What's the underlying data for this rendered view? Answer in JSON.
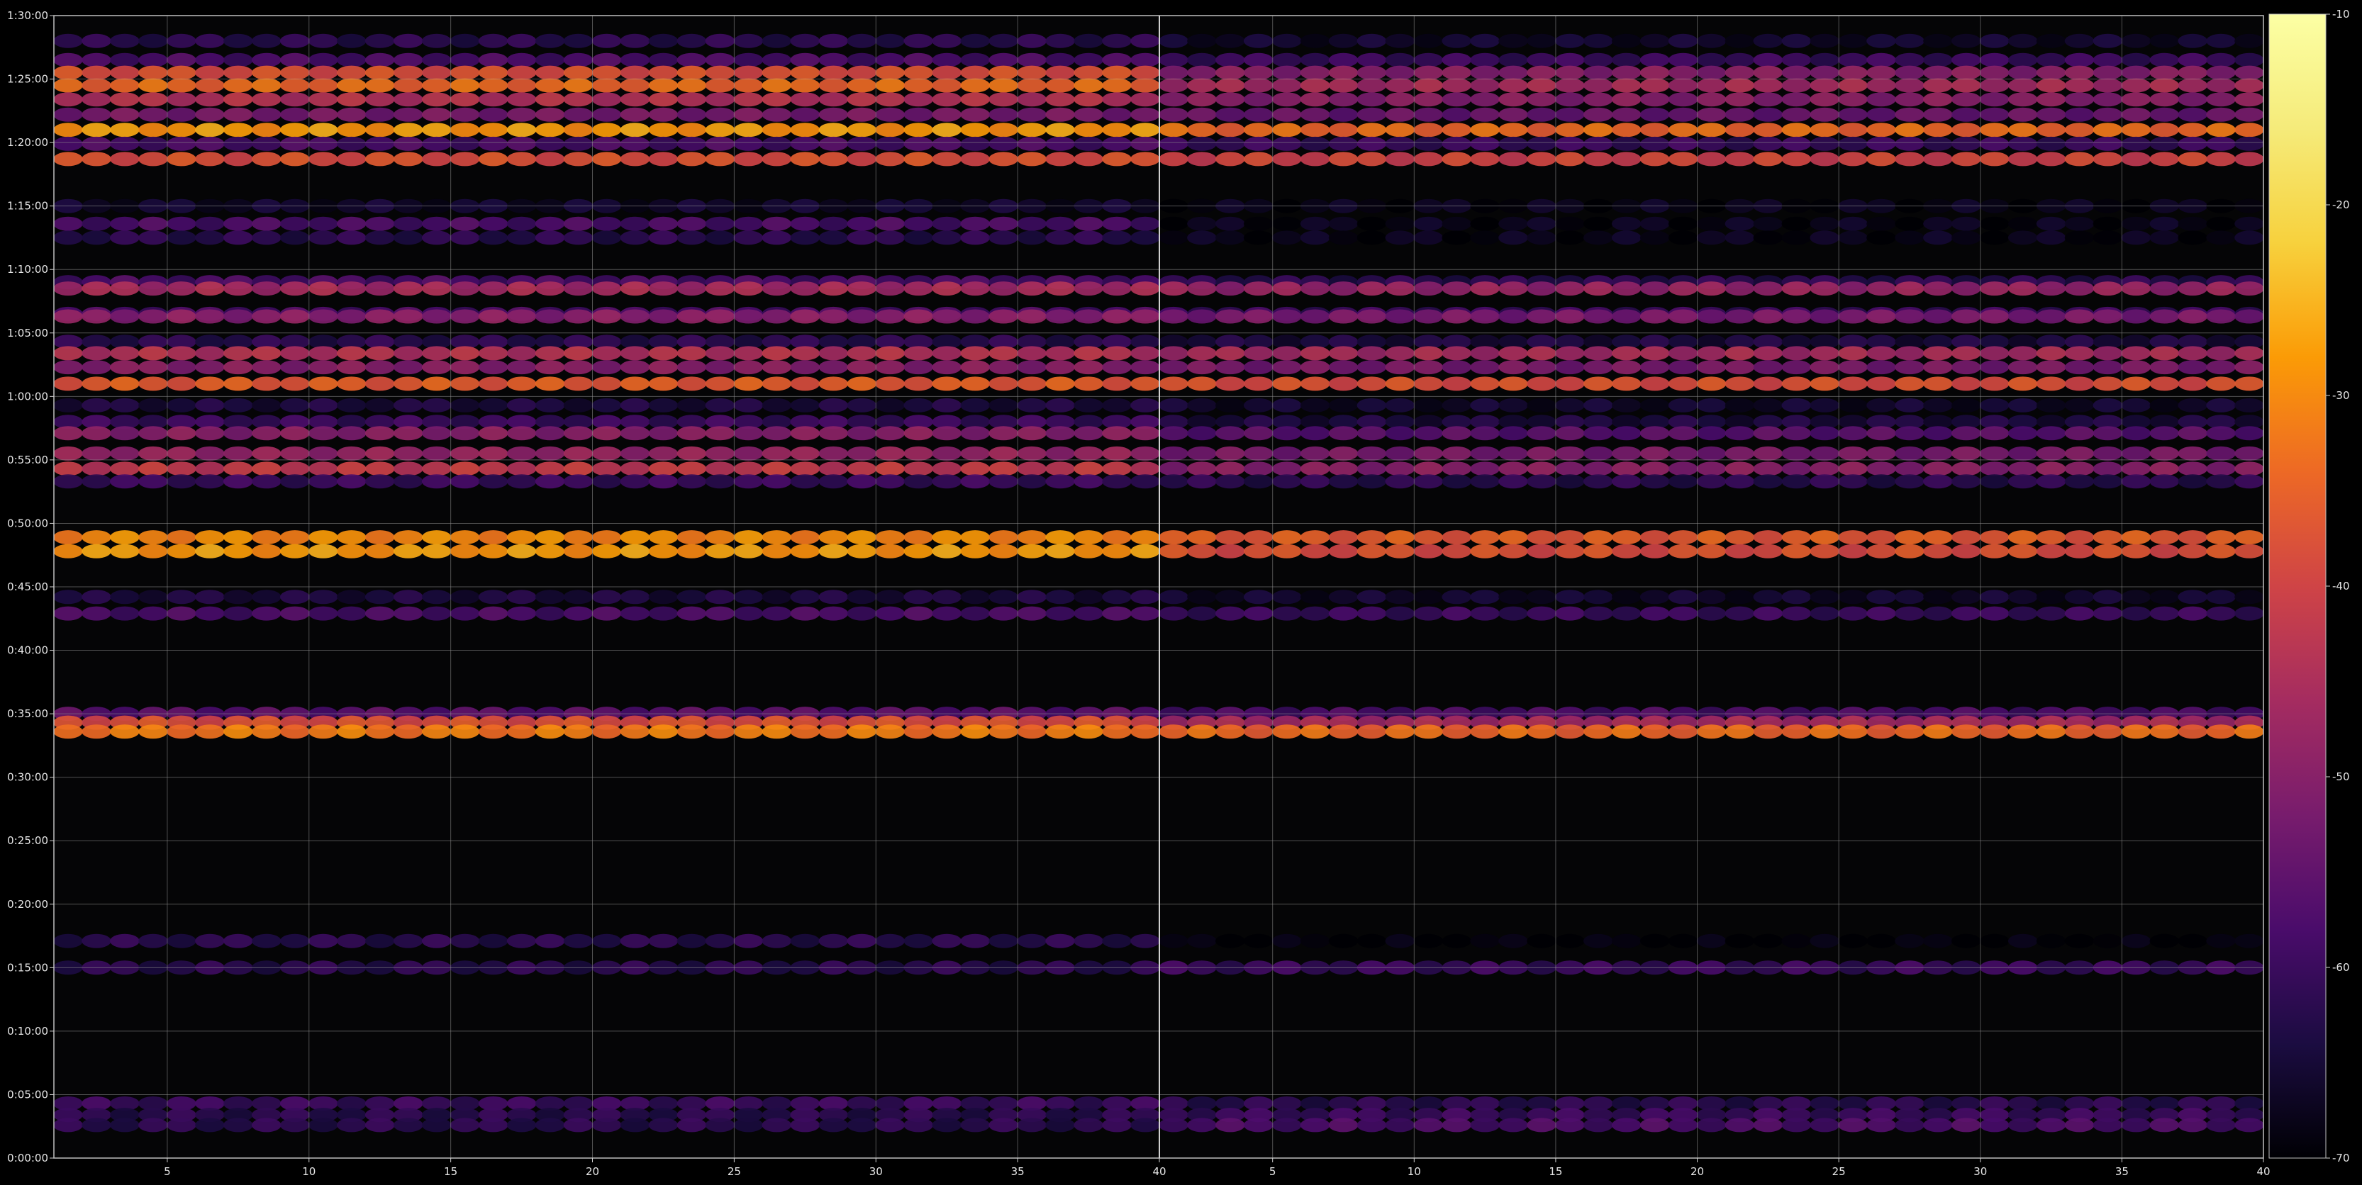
{
  "chart_data": {
    "type": "heatmap",
    "title": "",
    "xlabel": "",
    "ylabel": "",
    "grid": true,
    "background": "#000000",
    "colormap": "inferno",
    "panels": [
      {
        "x_range": [
          1,
          40
        ],
        "x_ticks": [
          "5",
          "10",
          "15",
          "20",
          "25",
          "30",
          "35",
          "40"
        ]
      },
      {
        "x_range": [
          40,
          79
        ],
        "x_ticks": [
          "5",
          "10",
          "15",
          "20",
          "25",
          "30",
          "35",
          "40"
        ]
      }
    ],
    "y_range_minutes": [
      0,
      90
    ],
    "y_ticks": [
      "0:00:00",
      "0:05:00",
      "0:10:00",
      "0:15:00",
      "0:20:00",
      "0:25:00",
      "0:30:00",
      "0:35:00",
      "0:40:00",
      "0:45:00",
      "0:50:00",
      "0:55:00",
      "1:00:00",
      "1:05:00",
      "1:10:00",
      "1:15:00",
      "1:20:00",
      "1:25:00",
      "1:30:00"
    ],
    "colorbar": {
      "min": -70,
      "max": -10,
      "ticks": [
        "-10",
        "-20",
        "-30",
        "-40",
        "-50",
        "-60",
        "-70"
      ]
    },
    "bands": [
      {
        "t_min": 88.0,
        "left": -62,
        "right": -66
      },
      {
        "t_min": 86.5,
        "left": -58,
        "right": -60
      },
      {
        "t_min": 85.5,
        "left": -38,
        "right": -50
      },
      {
        "t_min": 84.5,
        "left": -34,
        "right": -46
      },
      {
        "t_min": 83.4,
        "left": -44,
        "right": -50
      },
      {
        "t_min": 82.2,
        "left": -52,
        "right": -54
      },
      {
        "t_min": 81.0,
        "left": -28,
        "right": -34
      },
      {
        "t_min": 79.9,
        "left": -58,
        "right": -60
      },
      {
        "t_min": 78.7,
        "left": -38,
        "right": -40
      },
      {
        "t_min": 75.0,
        "left": -66,
        "right": -68
      },
      {
        "t_min": 73.6,
        "left": -58,
        "right": -68
      },
      {
        "t_min": 72.5,
        "left": -62,
        "right": -68
      },
      {
        "t_min": 69.0,
        "left": -58,
        "right": -62
      },
      {
        "t_min": 68.5,
        "left": -46,
        "right": -48
      },
      {
        "t_min": 66.5,
        "left": -58,
        "right": -60
      },
      {
        "t_min": 66.3,
        "left": -50,
        "right": -52
      },
      {
        "t_min": 64.3,
        "left": -62,
        "right": -64
      },
      {
        "t_min": 63.4,
        "left": -44,
        "right": -46
      },
      {
        "t_min": 62.3,
        "left": -50,
        "right": -52
      },
      {
        "t_min": 61.0,
        "left": -36,
        "right": -38
      },
      {
        "t_min": 59.3,
        "left": -64,
        "right": -66
      },
      {
        "t_min": 58.0,
        "left": -60,
        "right": -64
      },
      {
        "t_min": 57.1,
        "left": -50,
        "right": -56
      },
      {
        "t_min": 55.5,
        "left": -48,
        "right": -52
      },
      {
        "t_min": 54.3,
        "left": -42,
        "right": -50
      },
      {
        "t_min": 53.3,
        "left": -60,
        "right": -62
      },
      {
        "t_min": 48.9,
        "left": -30,
        "right": -36
      },
      {
        "t_min": 47.8,
        "left": -28,
        "right": -38
      },
      {
        "t_min": 44.2,
        "left": -64,
        "right": -66
      },
      {
        "t_min": 42.9,
        "left": -58,
        "right": -60
      },
      {
        "t_min": 35.0,
        "left": -56,
        "right": -58
      },
      {
        "t_min": 34.3,
        "left": -38,
        "right": -46
      },
      {
        "t_min": 33.6,
        "left": -32,
        "right": -34
      },
      {
        "t_min": 17.1,
        "left": -62,
        "right": -70
      },
      {
        "t_min": 15.0,
        "left": -62,
        "right": -60
      },
      {
        "t_min": 4.3,
        "left": -60,
        "right": -62
      },
      {
        "t_min": 3.4,
        "left": -62,
        "right": -60
      },
      {
        "t_min": 2.6,
        "left": -62,
        "right": -58
      }
    ]
  }
}
